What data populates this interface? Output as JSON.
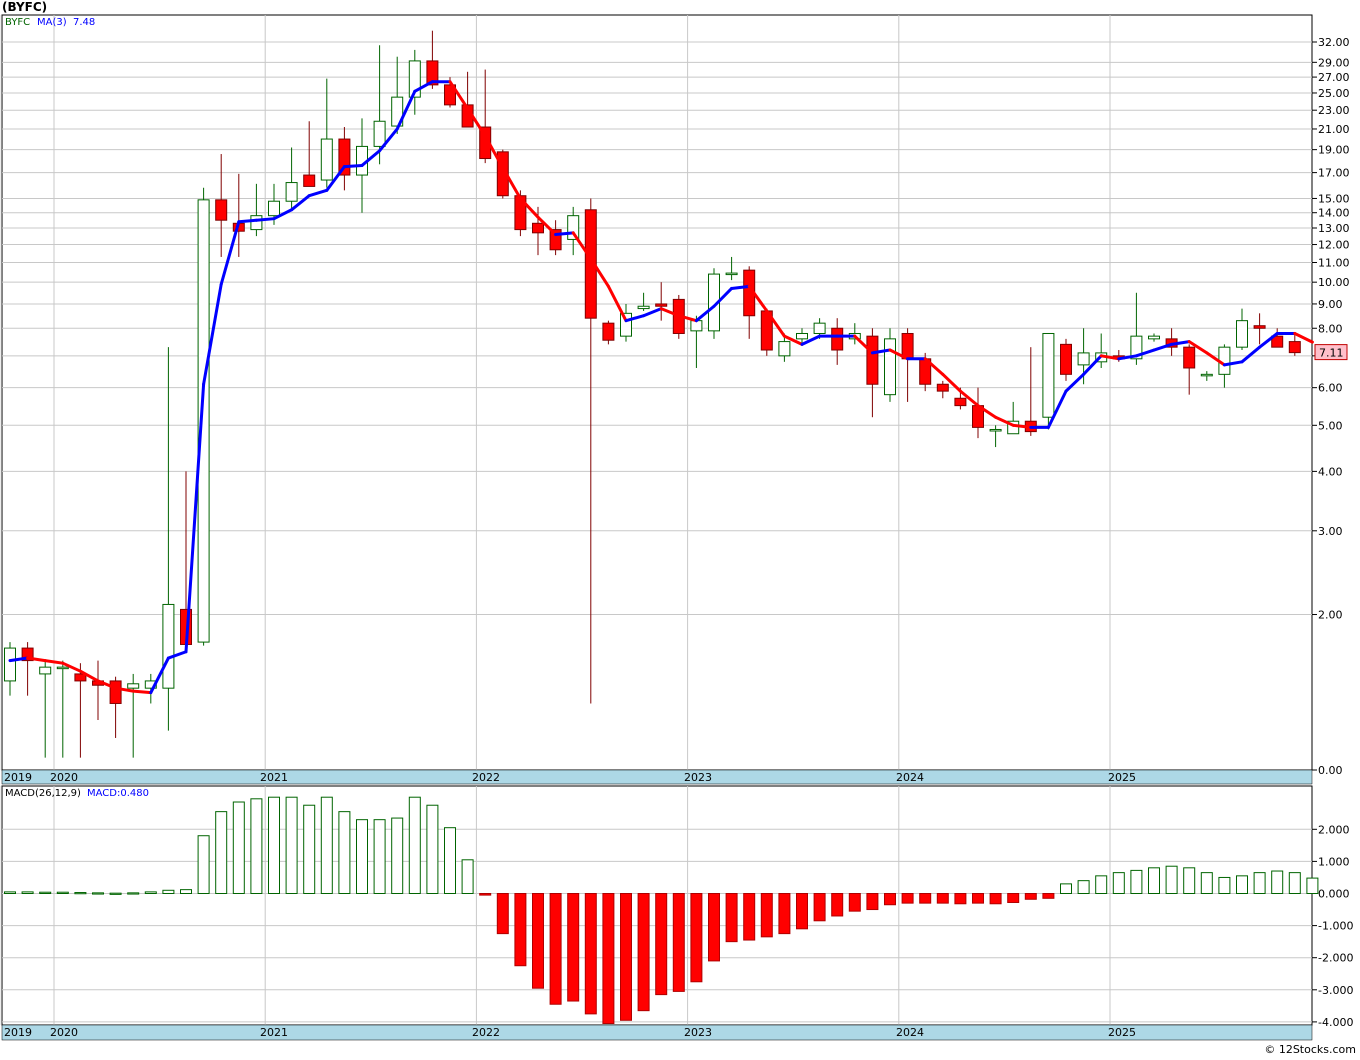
{
  "window": {
    "title": "(BYFC)",
    "credit": "© 12Stocks.com"
  },
  "price_panel": {
    "legend_symbol": "BYFC",
    "legend_ma_label": "MA(3)",
    "legend_ma_value": "7.48",
    "last_price_label": "7.11",
    "y_ticks": [
      "32.00",
      "29.00",
      "27.00",
      "25.00",
      "23.00",
      "21.00",
      "19.00",
      "17.00",
      "15.00",
      "14.00",
      "13.00",
      "12.00",
      "11.00",
      "10.00",
      "9.00",
      "8.00",
      "7.00",
      "6.00",
      "5.00",
      "4.00",
      "3.00",
      "2.00",
      "0.00"
    ],
    "x_ticks": [
      "2019",
      "2020",
      "2021",
      "2022",
      "2023",
      "2024",
      "2025"
    ]
  },
  "macd_panel": {
    "legend_label": "MACD(26,12,9)",
    "legend_value": "MACD:0.480",
    "y_ticks": [
      "2.000",
      "1.000",
      "0.000",
      "-1.000",
      "-2.000",
      "-3.000",
      "-4.000"
    ],
    "x_ticks": [
      "2019",
      "2020",
      "2021",
      "2022",
      "2023",
      "2024",
      "2025"
    ]
  },
  "colors": {
    "up_candle": "#006400",
    "down_candle": "#ff0000",
    "ma_up": "#0000ff",
    "ma_down": "#ff0000",
    "macd_pos": "#006400",
    "macd_neg": "#ff0000",
    "axis_band": "#add8e6",
    "grid": "#c8c8c8"
  },
  "chart_data": [
    {
      "type": "candlestick",
      "title": "(BYFC)",
      "scale": "log",
      "interval": "monthly",
      "x_axis": [
        "2019",
        "2020",
        "2021",
        "2022",
        "2023",
        "2024",
        "2025"
      ],
      "candles": [
        {
          "o": 1.45,
          "h": 1.75,
          "l": 1.35,
          "c": 1.7
        },
        {
          "o": 1.7,
          "h": 1.75,
          "l": 1.35,
          "c": 1.6
        },
        {
          "o": 1.5,
          "h": 1.6,
          "l": 1.0,
          "c": 1.55
        },
        {
          "o": 1.55,
          "h": 1.6,
          "l": 1.0,
          "c": 1.55
        },
        {
          "o": 1.5,
          "h": 1.58,
          "l": 1.0,
          "c": 1.45
        },
        {
          "o": 1.45,
          "h": 1.6,
          "l": 1.2,
          "c": 1.42
        },
        {
          "o": 1.45,
          "h": 1.48,
          "l": 1.1,
          "c": 1.3
        },
        {
          "o": 1.4,
          "h": 1.5,
          "l": 1.0,
          "c": 1.43
        },
        {
          "o": 1.4,
          "h": 1.5,
          "l": 1.3,
          "c": 1.45
        },
        {
          "o": 1.4,
          "h": 7.3,
          "l": 1.14,
          "c": 2.1
        },
        {
          "o": 2.05,
          "h": 4.0,
          "l": 1.72,
          "c": 1.73
        },
        {
          "o": 1.75,
          "h": 15.8,
          "l": 1.72,
          "c": 14.9
        },
        {
          "o": 14.9,
          "h": 18.6,
          "l": 11.3,
          "c": 13.5
        },
        {
          "o": 13.3,
          "h": 16.9,
          "l": 11.3,
          "c": 12.8
        },
        {
          "o": 12.9,
          "h": 16.1,
          "l": 12.5,
          "c": 13.8
        },
        {
          "o": 13.8,
          "h": 16.1,
          "l": 13.2,
          "c": 14.8
        },
        {
          "o": 14.8,
          "h": 19.2,
          "l": 14.2,
          "c": 16.2
        },
        {
          "o": 16.8,
          "h": 21.8,
          "l": 16.0,
          "c": 15.9
        },
        {
          "o": 16.4,
          "h": 26.8,
          "l": 15.8,
          "c": 20.0
        },
        {
          "o": 20.0,
          "h": 21.2,
          "l": 15.6,
          "c": 16.8
        },
        {
          "o": 16.8,
          "h": 22.1,
          "l": 14.0,
          "c": 19.3
        },
        {
          "o": 19.3,
          "h": 31.5,
          "l": 17.7,
          "c": 21.8
        },
        {
          "o": 21.3,
          "h": 29.8,
          "l": 20.5,
          "c": 24.5
        },
        {
          "o": 24.5,
          "h": 30.8,
          "l": 22.5,
          "c": 29.2
        },
        {
          "o": 29.2,
          "h": 33.8,
          "l": 25.5,
          "c": 26.0
        },
        {
          "o": 26.0,
          "h": 27.0,
          "l": 23.3,
          "c": 23.6
        },
        {
          "o": 23.6,
          "h": 27.7,
          "l": 21.5,
          "c": 21.2
        },
        {
          "o": 21.2,
          "h": 28.0,
          "l": 17.8,
          "c": 18.2
        },
        {
          "o": 18.8,
          "h": 19.0,
          "l": 15.0,
          "c": 15.2
        },
        {
          "o": 15.2,
          "h": 15.6,
          "l": 12.5,
          "c": 12.9
        },
        {
          "o": 13.3,
          "h": 14.4,
          "l": 11.4,
          "c": 12.7
        },
        {
          "o": 12.9,
          "h": 13.5,
          "l": 11.4,
          "c": 11.7
        },
        {
          "o": 12.3,
          "h": 14.4,
          "l": 11.4,
          "c": 13.8
        },
        {
          "o": 14.2,
          "h": 15.0,
          "l": 1.3,
          "c": 8.4
        },
        {
          "o": 8.2,
          "h": 8.3,
          "l": 7.4,
          "c": 7.55
        },
        {
          "o": 7.7,
          "h": 9.0,
          "l": 7.5,
          "c": 8.6
        },
        {
          "o": 8.8,
          "h": 9.5,
          "l": 8.7,
          "c": 8.9
        },
        {
          "o": 9.0,
          "h": 10.0,
          "l": 8.3,
          "c": 8.9
        },
        {
          "o": 9.2,
          "h": 9.4,
          "l": 7.6,
          "c": 7.8
        },
        {
          "o": 7.9,
          "h": 8.5,
          "l": 6.6,
          "c": 8.3
        },
        {
          "o": 7.9,
          "h": 10.7,
          "l": 7.6,
          "c": 10.4
        },
        {
          "o": 10.4,
          "h": 11.3,
          "l": 10.1,
          "c": 10.45
        },
        {
          "o": 10.6,
          "h": 10.8,
          "l": 7.6,
          "c": 8.5
        },
        {
          "o": 8.7,
          "h": 8.8,
          "l": 7.0,
          "c": 7.2
        },
        {
          "o": 7.0,
          "h": 7.8,
          "l": 6.8,
          "c": 7.5
        },
        {
          "o": 7.6,
          "h": 8.0,
          "l": 7.4,
          "c": 7.8
        },
        {
          "o": 7.8,
          "h": 8.4,
          "l": 7.6,
          "c": 8.2
        },
        {
          "o": 8.0,
          "h": 8.4,
          "l": 6.7,
          "c": 7.2
        },
        {
          "o": 7.6,
          "h": 8.2,
          "l": 7.4,
          "c": 7.8
        },
        {
          "o": 7.7,
          "h": 8.0,
          "l": 5.2,
          "c": 6.1
        },
        {
          "o": 5.8,
          "h": 8.0,
          "l": 5.6,
          "c": 7.6
        },
        {
          "o": 7.8,
          "h": 8.0,
          "l": 5.6,
          "c": 6.9
        },
        {
          "o": 6.9,
          "h": 7.1,
          "l": 5.9,
          "c": 6.1
        },
        {
          "o": 6.1,
          "h": 6.2,
          "l": 5.7,
          "c": 5.9
        },
        {
          "o": 5.7,
          "h": 6.0,
          "l": 5.4,
          "c": 5.5
        },
        {
          "o": 5.5,
          "h": 6.0,
          "l": 4.7,
          "c": 4.95
        },
        {
          "o": 4.9,
          "h": 5.0,
          "l": 4.5,
          "c": 4.9
        },
        {
          "o": 4.8,
          "h": 5.6,
          "l": 4.9,
          "c": 5.1
        },
        {
          "o": 5.1,
          "h": 7.3,
          "l": 4.75,
          "c": 4.85
        },
        {
          "o": 5.2,
          "h": 7.8,
          "l": 4.9,
          "c": 7.8
        },
        {
          "o": 7.4,
          "h": 7.6,
          "l": 6.2,
          "c": 6.4
        },
        {
          "o": 6.7,
          "h": 8.0,
          "l": 6.1,
          "c": 7.1
        },
        {
          "o": 6.8,
          "h": 7.8,
          "l": 6.6,
          "c": 7.1
        },
        {
          "o": 7.0,
          "h": 7.2,
          "l": 6.8,
          "c": 6.9
        },
        {
          "o": 6.9,
          "h": 9.5,
          "l": 6.7,
          "c": 7.7
        },
        {
          "o": 7.6,
          "h": 7.8,
          "l": 7.5,
          "c": 7.7
        },
        {
          "o": 7.6,
          "h": 8.0,
          "l": 7.0,
          "c": 7.3
        },
        {
          "o": 7.3,
          "h": 7.4,
          "l": 5.8,
          "c": 6.6
        },
        {
          "o": 6.4,
          "h": 6.5,
          "l": 6.2,
          "c": 6.4
        },
        {
          "o": 6.4,
          "h": 7.4,
          "l": 6.0,
          "c": 7.3
        },
        {
          "o": 7.3,
          "h": 8.8,
          "l": 7.2,
          "c": 8.3
        },
        {
          "o": 8.1,
          "h": 8.6,
          "l": 7.4,
          "c": 8.0
        },
        {
          "o": 7.7,
          "h": 8.0,
          "l": 7.3,
          "c": 7.3
        },
        {
          "o": 7.5,
          "h": 7.8,
          "l": 7.0,
          "c": 7.11
        }
      ],
      "ma3": [
        1.6,
        1.62,
        1.6,
        1.58,
        1.52,
        1.45,
        1.4,
        1.38,
        1.37,
        1.62,
        1.67,
        6.1,
        9.9,
        13.4,
        13.5,
        13.6,
        14.2,
        15.2,
        15.6,
        17.5,
        17.6,
        18.9,
        21.0,
        25.2,
        26.4,
        26.4,
        23.2,
        20.3,
        17.4,
        15.0,
        13.7,
        12.6,
        12.7,
        11.2,
        9.8,
        8.3,
        8.5,
        8.8,
        8.5,
        8.3,
        8.9,
        9.7,
        9.8,
        8.7,
        7.7,
        7.4,
        7.7,
        7.7,
        7.7,
        7.1,
        7.2,
        6.9,
        6.9,
        6.4,
        5.9,
        5.5,
        5.2,
        5.0,
        4.95,
        4.95,
        5.9,
        6.4,
        7.0,
        6.9,
        7.0,
        7.2,
        7.4,
        7.5,
        7.1,
        6.7,
        6.8,
        7.3,
        7.8,
        7.8,
        7.48
      ],
      "last": 7.11
    },
    {
      "type": "bar",
      "title": "MACD(26,12,9)",
      "last_value": 0.48,
      "values": [
        0.05,
        0.05,
        0.04,
        0.04,
        0.03,
        0.02,
        0.01,
        0.02,
        0.05,
        0.1,
        0.12,
        1.8,
        2.55,
        2.85,
        2.95,
        3.0,
        3.0,
        2.75,
        3.0,
        2.55,
        2.3,
        2.3,
        2.35,
        3.0,
        2.75,
        2.05,
        1.05,
        -0.05,
        -1.25,
        -2.25,
        -2.95,
        -3.45,
        -3.35,
        -3.75,
        -4.05,
        -3.95,
        -3.65,
        -3.15,
        -3.05,
        -2.75,
        -2.1,
        -1.5,
        -1.45,
        -1.35,
        -1.25,
        -1.1,
        -0.85,
        -0.7,
        -0.55,
        -0.5,
        -0.35,
        -0.3,
        -0.3,
        -0.3,
        -0.32,
        -0.3,
        -0.32,
        -0.28,
        -0.18,
        -0.15,
        0.3,
        0.4,
        0.55,
        0.65,
        0.72,
        0.8,
        0.85,
        0.8,
        0.65,
        0.5,
        0.55,
        0.65,
        0.7,
        0.65,
        0.48
      ],
      "ylim": [
        -4.0,
        2.0
      ]
    }
  ]
}
